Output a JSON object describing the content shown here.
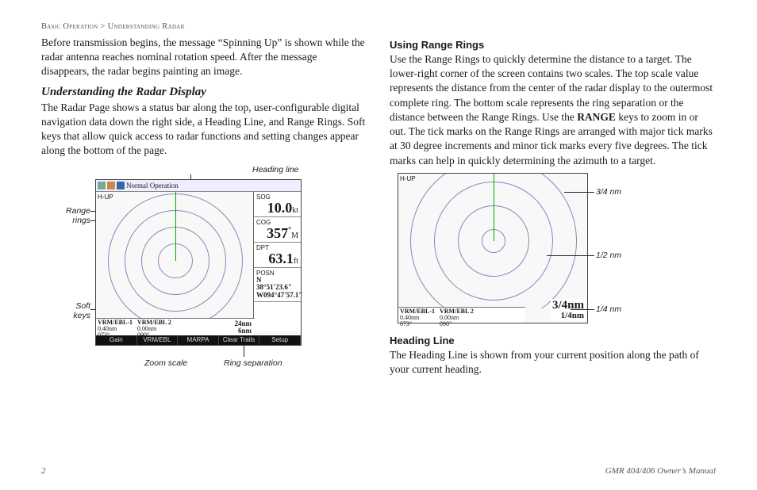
{
  "breadcrumb": {
    "a": "Basic Operation",
    "sep": ">",
    "b": "Understanding Radar"
  },
  "col1": {
    "p1": "Before transmission begins, the message “Spinning Up” is shown while the radar antenna reaches nominal rotation speed. After the message disappears, the radar begins painting an image.",
    "h3": "Understanding the Radar Display",
    "p2": "The Radar Page shows a status bar along the top, user-configurable digital navigation data down the right side, a Heading Line, and Range Rings. Soft keys that allow quick access to radar functions and setting changes appear along the bottom of the page."
  },
  "col2": {
    "h4a": "Using Range Rings",
    "p1a": "Use the Range Rings to quickly determine the distance to a target. The lower-right corner of the screen contains two scales. The top scale value represents the distance from the center of the radar display to the outermost complete ring. The bottom scale represents the ring separation or the distance between the Range Rings. Use the ",
    "rangeWord": "RANGE",
    "p1b": " keys to zoom in or out. The tick marks on the Range Rings are arranged with major tick marks at 30 degree increments and minor tick marks every five degrees. The tick marks can help in quickly determining the azimuth to a target.",
    "h4b": "Heading Line",
    "p2": "The Heading Line is shown from your current position along the path of your current heading."
  },
  "callouts": {
    "headingLine": "Heading line",
    "rangeRings": "Range rings",
    "softKeys": "Soft keys",
    "zoomScale": "Zoom scale",
    "ringSep": "Ring separation",
    "q34": "3/4 nm",
    "q12": "1/2 nm",
    "q14": "1/4 nm"
  },
  "radar": {
    "statusText": "Normal Operation",
    "hup": "H-UP",
    "sog": {
      "lbl": "SOG",
      "val": "10.0",
      "unit": "kt"
    },
    "cog": {
      "lbl": "COG",
      "val": "357",
      "unit": "M"
    },
    "dpt": {
      "lbl": "DPT",
      "val": "63.1",
      "unit": "ft"
    },
    "posn": {
      "lbl": "POSN",
      "l1": "N  38°51'23.6\"",
      "l2": "W094°47'57.1\""
    },
    "vrm": {
      "h1": "VRM/EBL-1",
      "v1a": "0.40nm",
      "v1b": "073°",
      "h2": "VRM/EBL 2",
      "v2a": "0.00nm",
      "v2b": "090°"
    },
    "scaleTop": "24nm",
    "scaleBot": "6nm",
    "scale2Top": "3/4nm",
    "scale2Bot": "1/4nm",
    "softkeys": [
      "Gain",
      "VRM/EBL",
      "MARPA",
      "Clear Trails",
      "Setup"
    ]
  },
  "footer": {
    "page": "2",
    "title": "GMR 404/406 Owner’s Manual"
  }
}
